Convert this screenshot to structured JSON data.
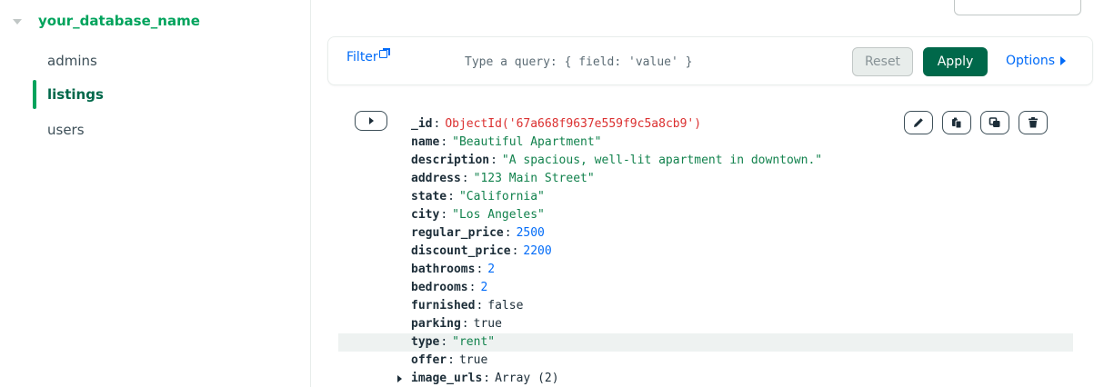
{
  "sidebar": {
    "database": "your_database_name",
    "collections": [
      {
        "label": "admins",
        "active": false
      },
      {
        "label": "listings",
        "active": true
      },
      {
        "label": "users",
        "active": false
      }
    ]
  },
  "filter": {
    "label": "Filter",
    "placeholder": "Type a query: { field: 'value' }",
    "reset_label": "Reset",
    "apply_label": "Apply",
    "options_label": "Options"
  },
  "document": {
    "fields": [
      {
        "key": "_id",
        "value": "ObjectId('67a668f9637e559f9c5a8cb9')",
        "type": "oid"
      },
      {
        "key": "name",
        "value": "\"Beautiful Apartment\"",
        "type": "str"
      },
      {
        "key": "description",
        "value": "\"A spacious, well-lit apartment in downtown.\"",
        "type": "str"
      },
      {
        "key": "address",
        "value": "\"123 Main Street\"",
        "type": "str"
      },
      {
        "key": "state",
        "value": "\"California\"",
        "type": "str"
      },
      {
        "key": "city",
        "value": "\"Los Angeles\"",
        "type": "str"
      },
      {
        "key": "regular_price",
        "value": "2500",
        "type": "num"
      },
      {
        "key": "discount_price",
        "value": "2200",
        "type": "num"
      },
      {
        "key": "bathrooms",
        "value": "2",
        "type": "num"
      },
      {
        "key": "bedrooms",
        "value": "2",
        "type": "num"
      },
      {
        "key": "furnished",
        "value": "false",
        "type": "bool"
      },
      {
        "key": "parking",
        "value": "true",
        "type": "bool"
      },
      {
        "key": "type",
        "value": "\"rent\"",
        "type": "str"
      },
      {
        "key": "offer",
        "value": "true",
        "type": "bool"
      },
      {
        "key": "image_urls",
        "value": "Array (2)",
        "type": "array"
      }
    ],
    "actions": [
      "edit-icon",
      "copy-icon",
      "clone-icon",
      "delete-icon"
    ]
  },
  "colors": {
    "brand_green": "#00684a",
    "link_blue": "#016bf8",
    "string_green": "#12824d",
    "objectid_red": "#db3030"
  }
}
